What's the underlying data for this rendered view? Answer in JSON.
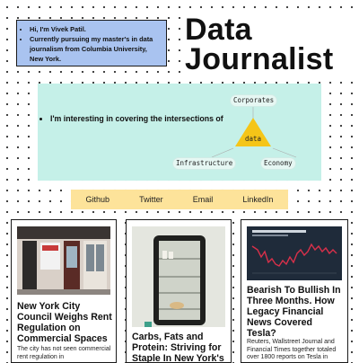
{
  "intro": {
    "line1": "Hi, I'm Vivek Patil.",
    "line2": "Currently pursuing my master's in data journalism from Columbia University, New York."
  },
  "header": {
    "title_line1": "Data",
    "title_line2": "Journalist"
  },
  "interests": {
    "text": "I'm interesting in covering the intersections of",
    "diagram": {
      "top": "Corporates",
      "center": "data",
      "left": "Infrastructure",
      "right": "Economy"
    }
  },
  "links": [
    "Github",
    "Twitter",
    "Email",
    "LinkedIn"
  ],
  "articles": [
    {
      "title": "New York City Council Weighs Rent Regulation on Commercial Spaces",
      "excerpt": "The city has not seen commercial rent regulation in"
    },
    {
      "title": "Carbs, Fats and Protein: Striving for Staple In New York's",
      "excerpt": ""
    },
    {
      "title": "Bearish To Bullish In Three Months. How Legacy Financial News Covered Tesla?",
      "excerpt": "Reuters, Wallstreet Journal and Financial Times together totaled over 1800 reports on Tesla in"
    }
  ],
  "colors": {
    "intro_bg": "#a9c3f0",
    "interest_bg": "#c5f0e8",
    "links_bg": "#fde39a",
    "triangle": "#f5c518",
    "chart_bg": "#1f2b3a",
    "chart_line": "#d8304a"
  }
}
